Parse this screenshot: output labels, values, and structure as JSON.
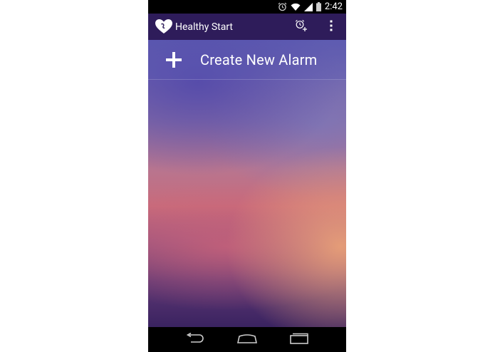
{
  "status_bar": {
    "time": "2:42",
    "icons": [
      "alarm-icon",
      "wifi-icon",
      "signal-icon",
      "battery-icon"
    ]
  },
  "action_bar": {
    "app_name": "Healthy Start",
    "app_icon": "heart-icon",
    "actions": [
      "add-alarm-icon",
      "overflow-menu-icon"
    ]
  },
  "main": {
    "create_label": "Create New Alarm",
    "create_icon": "plus-icon"
  },
  "nav_bar": {
    "buttons": [
      "back-icon",
      "home-icon",
      "recents-icon"
    ]
  },
  "colors": {
    "action_bar": "#2e1c5a",
    "status_bar": "#000000",
    "text": "#ffffff"
  }
}
